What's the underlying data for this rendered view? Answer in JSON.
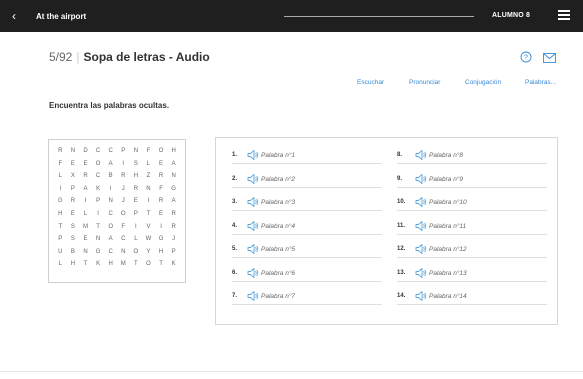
{
  "topbar": {
    "back_icon": "chevron-left-icon",
    "title": "At the airport",
    "user": "ALUMNO 8",
    "menu_icon": "hamburger-menu-icon"
  },
  "header": {
    "progress": "5/92",
    "separator": "|",
    "title": "Sopa de letras - Audio"
  },
  "icons": {
    "help": "help-circle-icon",
    "mail": "mail-icon"
  },
  "tabs": [
    "Escuchar",
    "Pronunciar",
    "Conjugación",
    "Palabras..."
  ],
  "instruction": "Encuentra las palabras ocultas.",
  "grid": [
    [
      "R",
      "N",
      "D",
      "C",
      "C",
      "P",
      "N",
      "F",
      "O",
      "H"
    ],
    [
      "F",
      "E",
      "E",
      "O",
      "A",
      "I",
      "S",
      "L",
      "E",
      "A"
    ],
    [
      "L",
      "X",
      "R",
      "C",
      "B",
      "R",
      "H",
      "Z",
      "R",
      "N"
    ],
    [
      "I",
      "P",
      "A",
      "K",
      "I",
      "J",
      "R",
      "N",
      "F",
      "G"
    ],
    [
      "G",
      "R",
      "I",
      "P",
      "N",
      "J",
      "E",
      "I",
      "R",
      "A"
    ],
    [
      "H",
      "E",
      "L",
      "I",
      "C",
      "O",
      "P",
      "T",
      "E",
      "R"
    ],
    [
      "T",
      "S",
      "M",
      "T",
      "O",
      "F",
      "I",
      "V",
      "I",
      "R"
    ],
    [
      "P",
      "S",
      "E",
      "N",
      "A",
      "C",
      "L",
      "W",
      "G",
      "J"
    ],
    [
      "U",
      "B",
      "N",
      "G",
      "C",
      "N",
      "O",
      "Y",
      "H",
      "P"
    ],
    [
      "L",
      "H",
      "T",
      "K",
      "H",
      "M",
      "T",
      "O",
      "T",
      "K"
    ]
  ],
  "words": [
    {
      "num": "1.",
      "label": "Palabra n°1"
    },
    {
      "num": "2.",
      "label": "Palabra n°2"
    },
    {
      "num": "3.",
      "label": "Palabra n°3"
    },
    {
      "num": "4.",
      "label": "Palabra n°4"
    },
    {
      "num": "5.",
      "label": "Palabra n°5"
    },
    {
      "num": "6.",
      "label": "Palabra n°6"
    },
    {
      "num": "7.",
      "label": "Palabra n°7"
    },
    {
      "num": "8.",
      "label": "Palabra n°8"
    },
    {
      "num": "9.",
      "label": "Palabra n°9"
    },
    {
      "num": "10.",
      "label": "Palabra n°10"
    },
    {
      "num": "11.",
      "label": "Palabra n°11"
    },
    {
      "num": "12.",
      "label": "Palabra n°12"
    },
    {
      "num": "13.",
      "label": "Palabra n°13"
    },
    {
      "num": "14.",
      "label": "Palabra n°14"
    }
  ],
  "colors": {
    "topbar": "#1f1f1f",
    "accent": "#3a8bd6",
    "speaker": "#5aa7e0"
  }
}
